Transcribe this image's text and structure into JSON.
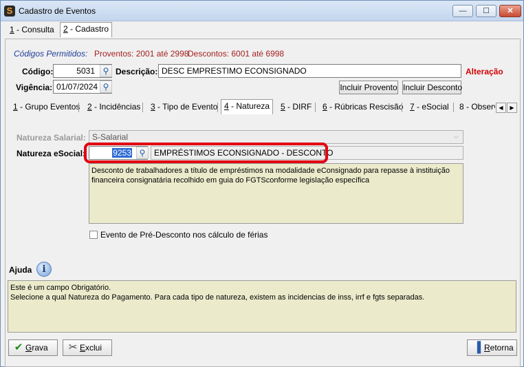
{
  "window": {
    "title": "Cadastro de Eventos",
    "minimize_glyph": "—",
    "maximize_glyph": "☐",
    "close_glyph": "✕",
    "icon": "app-logo-icon"
  },
  "top_tabs": [
    {
      "key": "1",
      "label": " - Consulta"
    },
    {
      "key": "2",
      "label": " - Cadastro"
    }
  ],
  "header": {
    "allowed_codes_label": "Códigos Permitidos:",
    "proventos_text": "Proventos: 2001 até 2998",
    "descontos_text": "Descontos: 6001 até 6998",
    "codigo_label": "Código:",
    "codigo_value": "5031",
    "descricao_label": "Descrição:",
    "descricao_value": "DESC EMPRESTIMO ECONSIGNADO",
    "mode_status": "Alteração",
    "vigencia_label": "Vigência:",
    "vigencia_value": "01/07/2024",
    "incluir_provento_label": "Incluir Provento",
    "incluir_desconto_label": "Incluir Desconto"
  },
  "section_tabs": [
    {
      "key": "1",
      "label": " - Grupo Eventos"
    },
    {
      "key": "2",
      "label": " - Incidências"
    },
    {
      "key": "3",
      "label": " - Tipo de Evento"
    },
    {
      "key": "4",
      "label": " - Natureza"
    },
    {
      "key": "5",
      "label": " - DIRF"
    },
    {
      "key": "6",
      "label": " - Rúbricas Rescisão"
    },
    {
      "key": "7",
      "label": " - eSocial"
    },
    {
      "key": "8",
      "label": " - Observa"
    }
  ],
  "natureza": {
    "salarial_label": "Natureza Salarial:",
    "salarial_value": "S-Salarial",
    "esocial_label": "Natureza eSocial:",
    "esocial_code": "9253",
    "esocial_description": "EMPRÉSTIMOS ECONSIGNADO - DESCONTO",
    "esocial_details": "Desconto de trabalhadores a título de empréstimos na modalidade eConsignado para repasse à instituição financeira consignatária recolhido em guia do FGTSconforme legislação específica",
    "pre_desconto_label": "Evento de Pré-Desconto nos cálculo de férias",
    "pre_desconto_checked": false
  },
  "ajuda": {
    "label": "Ajuda",
    "text": "Este é um campo Obrigatório.\nSelecione a qual Natureza do Pagamento. Para cada tipo de natureza, existem as incidencias de inss, irrf e fgts separadas."
  },
  "footer": {
    "grava_key": "G",
    "grava_rest": "rava",
    "exclui_key": "E",
    "exclui_rest": "xclui",
    "retorna_key": "R",
    "retorna_rest": "etorna"
  },
  "colors": {
    "status_red": "#d40000",
    "codes_blue": "#1f3d99",
    "codes_red": "#a52020",
    "highlight_red": "#e10010",
    "memo_bg": "#ebebcc"
  }
}
